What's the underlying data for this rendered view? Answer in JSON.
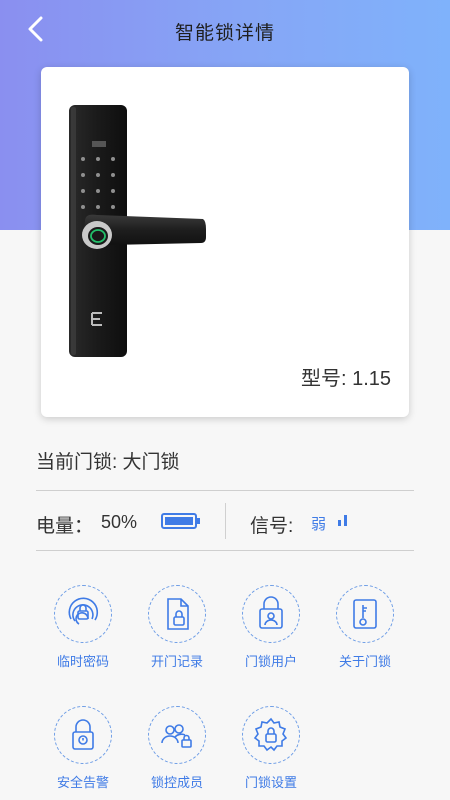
{
  "header": {
    "title": "智能锁详情",
    "back_icon": "chevron-left-icon"
  },
  "card": {
    "model_text": "型号: 1.15"
  },
  "current_lock": "当前门锁: 大门锁",
  "status": {
    "battery_label": "电量：",
    "battery_value": "50%",
    "battery_level": 0.5,
    "signal_label": "信号:",
    "signal_value": "弱",
    "accent_color": "#3f7be6"
  },
  "menu": [
    {
      "label": "临时密码",
      "icon": "fingerprint-lock-icon"
    },
    {
      "label": "开门记录",
      "icon": "document-lock-icon"
    },
    {
      "label": "门锁用户",
      "icon": "lock-user-icon"
    },
    {
      "label": "关于门锁",
      "icon": "key-icon"
    },
    {
      "label": "安全告警",
      "icon": "alarm-lock-icon"
    },
    {
      "label": "锁控成员",
      "icon": "members-lock-icon"
    },
    {
      "label": "门锁设置",
      "icon": "gear-lock-icon"
    }
  ]
}
